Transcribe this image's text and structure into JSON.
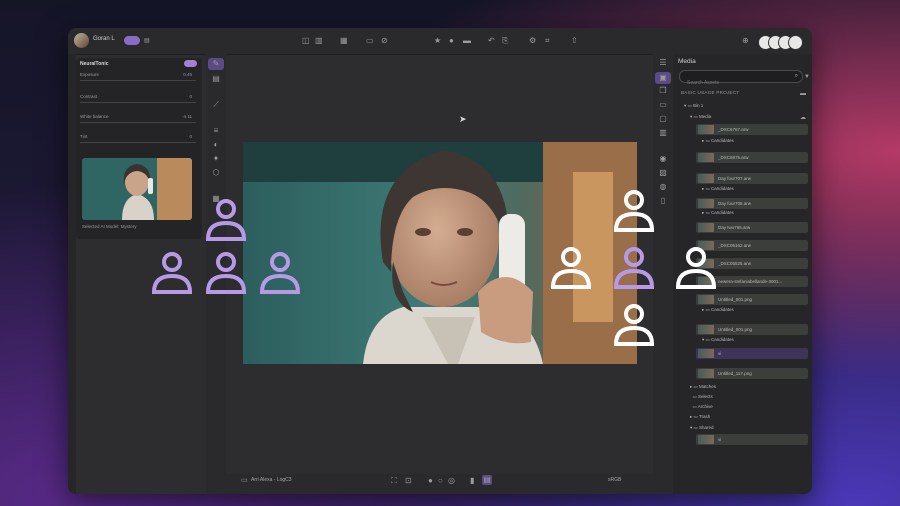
{
  "topbar": {
    "user_name": "Goran L"
  },
  "left_panel": {
    "title": "NeuralTonic",
    "sliders": [
      {
        "label": "Exposure",
        "value": "0.45"
      },
      {
        "label": "Contrast",
        "value": "0"
      },
      {
        "label": "White balance",
        "value": "-4.11"
      },
      {
        "label": "Tint",
        "value": "0"
      }
    ],
    "thumbnail_caption": "Selected AI Model: Mystery"
  },
  "bottom_bar": {
    "camera_label": "Arri Alexa - LogC3",
    "colorspace": "sRGB"
  },
  "media_panel": {
    "title": "Media",
    "search_placeholder": "Search Assets",
    "section_label": "BASIC USAGE PROJECT",
    "root_folder": "Bin 1",
    "media_folder": "Media",
    "rows": [
      {
        "name": "_DSC6767.arw",
        "folder": "Candidates"
      },
      {
        "name": "_DSC6875.arw"
      },
      {
        "name": "Day four707.arw",
        "folder": "Candidates"
      },
      {
        "name": "Day four708.arw",
        "folder": "Candidates"
      },
      {
        "name": "Day two765.arw"
      },
      {
        "name": "_DSC05162.arw"
      },
      {
        "name": "_DSC05525.arw"
      },
      {
        "name": "newera-stefaniabellande-3001..."
      },
      {
        "name": "Untitled_001.png",
        "folder": "Candidates"
      },
      {
        "name": "Untitled_001.png",
        "folder": "Candidates"
      },
      {
        "name": "vi"
      },
      {
        "name": "Untitled_117.png"
      }
    ],
    "folders": [
      "Matches",
      "Selects",
      "Archive",
      "Trash",
      "Shared"
    ],
    "shared_item": "vi"
  },
  "overlay": {
    "left_group_color": "#b79ae6",
    "right_group_color": "#ffffff",
    "right_accent_color": "#b79ae6"
  }
}
